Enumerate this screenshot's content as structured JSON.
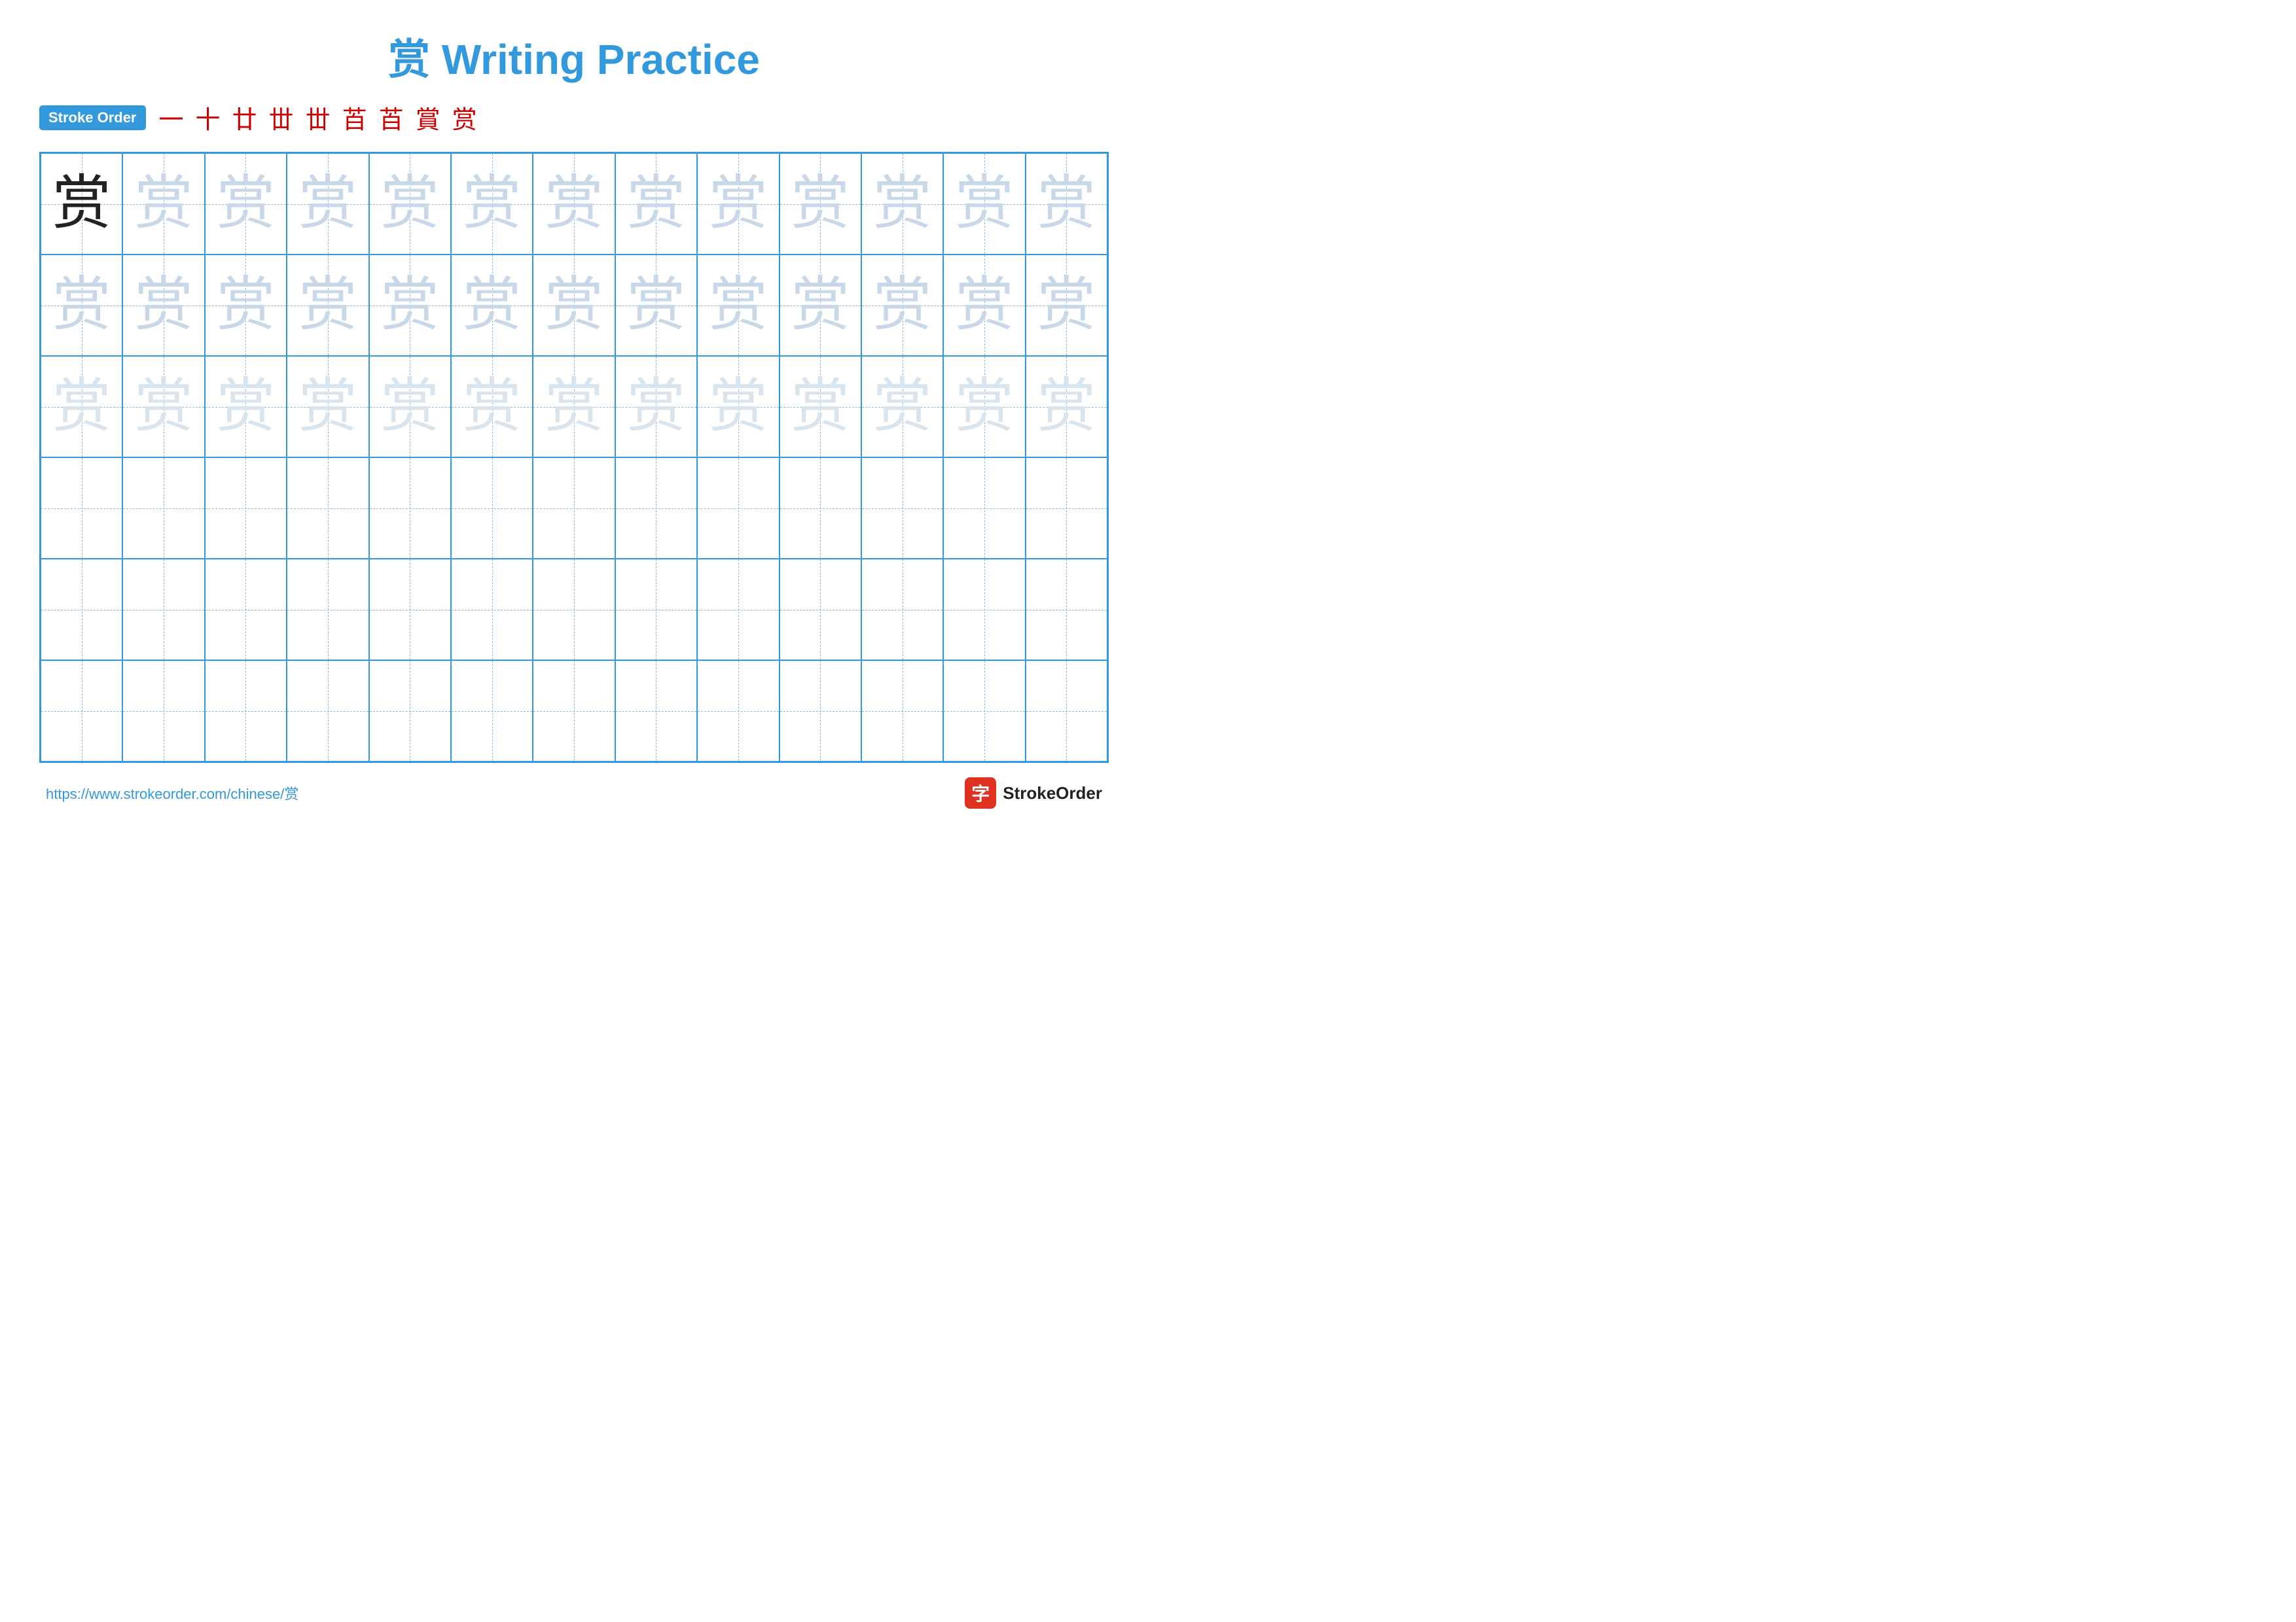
{
  "title": {
    "char": "赏",
    "text": " Writing Practice"
  },
  "stroke_order": {
    "badge_label": "Stroke Order",
    "strokes": [
      "一",
      "十",
      "廿",
      "世",
      "世",
      "苩",
      "苩",
      "賞",
      "赏"
    ]
  },
  "grid": {
    "rows": 6,
    "cols": 13,
    "char": "赏",
    "row1_style": "dark_then_light1",
    "row2_style": "light1",
    "row3_style": "light2",
    "row4_style": "empty",
    "row5_style": "empty",
    "row6_style": "empty"
  },
  "footer": {
    "url": "https://www.strokeorder.com/chinese/赏",
    "logo_char": "字",
    "logo_text": "StrokeOrder"
  }
}
